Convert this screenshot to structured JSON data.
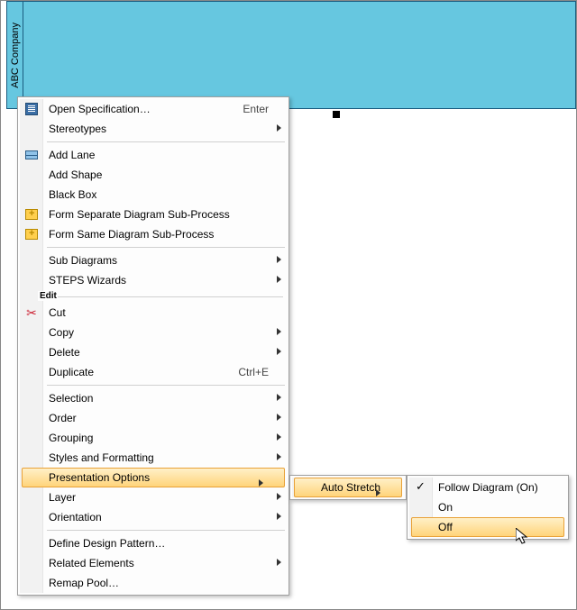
{
  "pool": {
    "title": "ABC Company"
  },
  "main_menu": {
    "open_spec": "Open Specification…",
    "open_spec_accel": "Enter",
    "stereotypes": "Stereotypes",
    "add_lane": "Add Lane",
    "add_shape": "Add Shape",
    "black_box": "Black Box",
    "form_sep": "Form Separate Diagram Sub-Process",
    "form_same": "Form Same Diagram Sub-Process",
    "sub_diagrams": "Sub Diagrams",
    "steps": "STEPS Wizards",
    "edit_label": "Edit",
    "cut": "Cut",
    "copy": "Copy",
    "delete": "Delete",
    "duplicate": "Duplicate",
    "duplicate_accel": "Ctrl+E",
    "selection": "Selection",
    "order": "Order",
    "grouping": "Grouping",
    "styles": "Styles and Formatting",
    "presentation": "Presentation Options",
    "layer": "Layer",
    "orientation": "Orientation",
    "define_pattern": "Define Design Pattern…",
    "related": "Related Elements",
    "remap": "Remap Pool…"
  },
  "submenu1": {
    "auto_stretch": "Auto Stretch"
  },
  "submenu2": {
    "follow": "Follow Diagram (On)",
    "on": "On",
    "off": "Off"
  }
}
